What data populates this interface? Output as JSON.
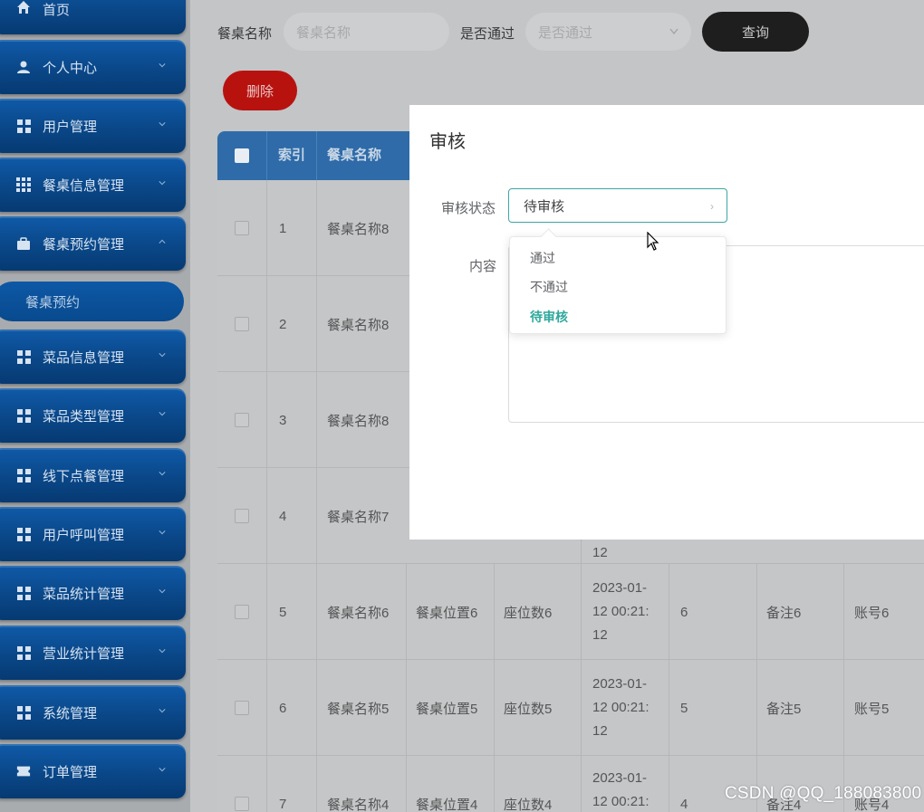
{
  "sidebar": {
    "home": "首页",
    "items": [
      {
        "label": "个人中心",
        "icon": "person-icon"
      },
      {
        "label": "用户管理",
        "icon": "grid-icon"
      },
      {
        "label": "餐桌信息管理",
        "icon": "apps-icon"
      },
      {
        "label": "餐桌预约管理",
        "icon": "briefcase-icon"
      },
      {
        "label": "菜品信息管理",
        "icon": "grid-icon"
      },
      {
        "label": "菜品类型管理",
        "icon": "grid-icon"
      },
      {
        "label": "线下点餐管理",
        "icon": "grid-icon"
      },
      {
        "label": "用户呼叫管理",
        "icon": "grid-icon"
      },
      {
        "label": "菜品统计管理",
        "icon": "grid-icon"
      },
      {
        "label": "营业统计管理",
        "icon": "grid-icon"
      },
      {
        "label": "系统管理",
        "icon": "grid-icon"
      },
      {
        "label": "订单管理",
        "icon": "ticket-icon"
      }
    ],
    "sub_item": "餐桌预约"
  },
  "search": {
    "table_name_label": "餐桌名称",
    "table_name_placeholder": "餐桌名称",
    "approved_label": "是否通过",
    "approved_placeholder": "是否通过",
    "query_button": "查询"
  },
  "toolbar": {
    "delete_button": "删除"
  },
  "table": {
    "headers": [
      "索引",
      "餐桌名称"
    ],
    "rows": [
      {
        "index": "1",
        "name": "餐桌名称8",
        "location": "",
        "seats": "",
        "time": [],
        "count": "",
        "remark": "",
        "account": ""
      },
      {
        "index": "2",
        "name": "餐桌名称8",
        "location": "",
        "seats": "",
        "time": [],
        "count": "",
        "remark": "",
        "account": ""
      },
      {
        "index": "3",
        "name": "餐桌名称8",
        "location": "",
        "seats": "",
        "time": [],
        "count": "",
        "remark": "",
        "account": ""
      },
      {
        "index": "4",
        "name": "餐桌名称7",
        "location": "",
        "seats": "",
        "time": [
          "12"
        ],
        "count": "",
        "remark": "",
        "account": ""
      },
      {
        "index": "5",
        "name": "餐桌名称6",
        "location": "餐桌位置6",
        "seats": "座位数6",
        "time": [
          "2023-01-",
          "12 00:21:",
          "12"
        ],
        "count": "6",
        "remark": "备注6",
        "account": "账号6"
      },
      {
        "index": "6",
        "name": "餐桌名称5",
        "location": "餐桌位置5",
        "seats": "座位数5",
        "time": [
          "2023-01-",
          "12 00:21:",
          "12"
        ],
        "count": "5",
        "remark": "备注5",
        "account": "账号5"
      },
      {
        "index": "7",
        "name": "餐桌名称4",
        "location": "餐桌位置4",
        "seats": "座位数4",
        "time": [
          "2023-01-",
          "12 00:21:"
        ],
        "count": "4",
        "remark": "备注4",
        "account": "账号4"
      }
    ]
  },
  "modal": {
    "title": "审核",
    "status_label": "审核状态",
    "status_value": "待审核",
    "content_label": "内容",
    "options": [
      "通过",
      "不通过",
      "待审核"
    ],
    "selected_option": "待审核"
  },
  "watermark": "CSDN @QQ_188083800",
  "colors": {
    "accent": "#2fa89c",
    "sidebar": "#0a4788",
    "delete": "#b8120f",
    "query": "#1e1e1e"
  }
}
